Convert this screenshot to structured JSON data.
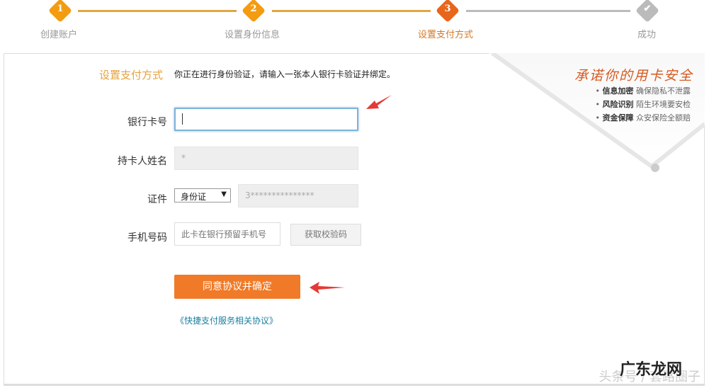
{
  "steps": [
    {
      "num": "1",
      "label": "创建账户",
      "state": "done"
    },
    {
      "num": "2",
      "label": "设置身份信息",
      "state": "done"
    },
    {
      "num": "3",
      "label": "设置支付方式",
      "state": "current"
    },
    {
      "num": "✔",
      "label": "成功",
      "state": "todo"
    }
  ],
  "colors": {
    "done": "#f39c12",
    "current": "#e8661c",
    "todo": "#bbbbbb",
    "accent": "#f07a27"
  },
  "section": {
    "title": "设置支付方式",
    "desc": "你正在进行身份验证，请输入一张本人银行卡验证并绑定。"
  },
  "promo": {
    "title": "承诺你的用卡安全",
    "items": [
      {
        "bold": "信息加密",
        "text": "确保隐私不泄露"
      },
      {
        "bold": "风险识别",
        "text": "陌生环境要安检"
      },
      {
        "bold": "资金保障",
        "text": "众安保险全额赔"
      }
    ]
  },
  "form": {
    "card_label": "银行卡号",
    "card_value": "",
    "name_label": "持卡人姓名",
    "name_value": "*",
    "id_label": "证件",
    "id_type": "身份证",
    "id_value": "3***************",
    "phone_label": "手机号码",
    "phone_placeholder": "此卡在银行预留手机号",
    "code_button": "获取校验码",
    "submit": "同意协议并确定",
    "agreement_link": "《快捷支付服务相关协议》"
  },
  "watermark": {
    "source": "头条号 / 套路圈子",
    "site": "广东龙网"
  }
}
